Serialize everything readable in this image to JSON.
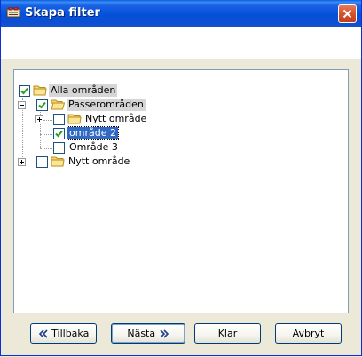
{
  "window": {
    "title": "Skapa filter"
  },
  "tree": {
    "items": [
      {
        "label": "Alla områden",
        "checked": true,
        "state": "highlighted"
      },
      {
        "label": "Passerområden",
        "checked": true,
        "state": "highlighted",
        "expanded": true
      },
      {
        "label": "Nytt område",
        "checked": false,
        "state": "normal",
        "expanded": false
      },
      {
        "label": "område 2",
        "checked": true,
        "state": "selected"
      },
      {
        "label": "Område 3",
        "checked": false,
        "state": "normal"
      },
      {
        "label": "Nytt område",
        "checked": false,
        "state": "normal",
        "expanded": false
      }
    ]
  },
  "buttons": {
    "back": "Tillbaka",
    "next": "Nästa",
    "finish": "Klar",
    "cancel": "Avbryt"
  },
  "colors": {
    "titlebar": "#0A5FE4",
    "selection": "#316AC5",
    "highlight": "#D6D6D6",
    "close": "#D4532F"
  }
}
